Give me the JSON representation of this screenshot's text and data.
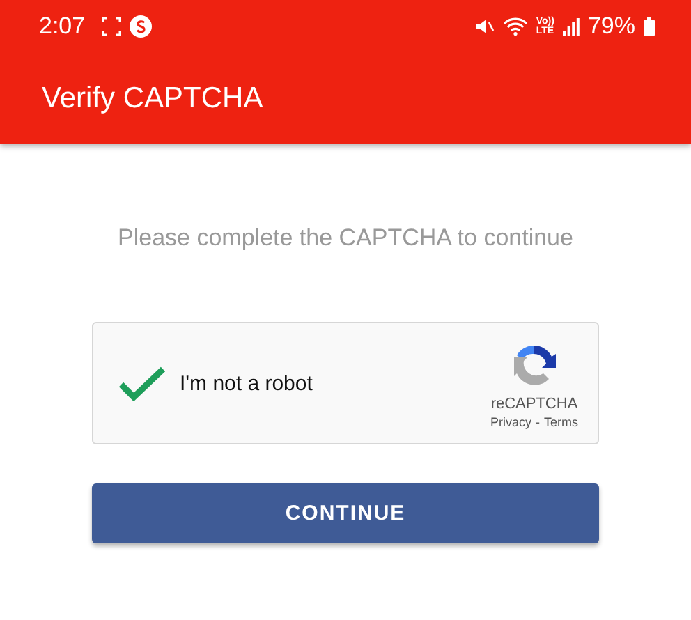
{
  "status_bar": {
    "time": "2:07",
    "volte_top": "Vo))",
    "volte_bottom": "LTE",
    "battery": "79%"
  },
  "app_bar": {
    "title": "Verify CAPTCHA"
  },
  "prompt": "Please complete the CAPTCHA to continue",
  "captcha": {
    "label": "I'm not a robot",
    "checked": true,
    "brand": "reCAPTCHA",
    "links": [
      "Privacy",
      "Terms"
    ],
    "separator": "-"
  },
  "button": {
    "label": "CONTINUE"
  }
}
